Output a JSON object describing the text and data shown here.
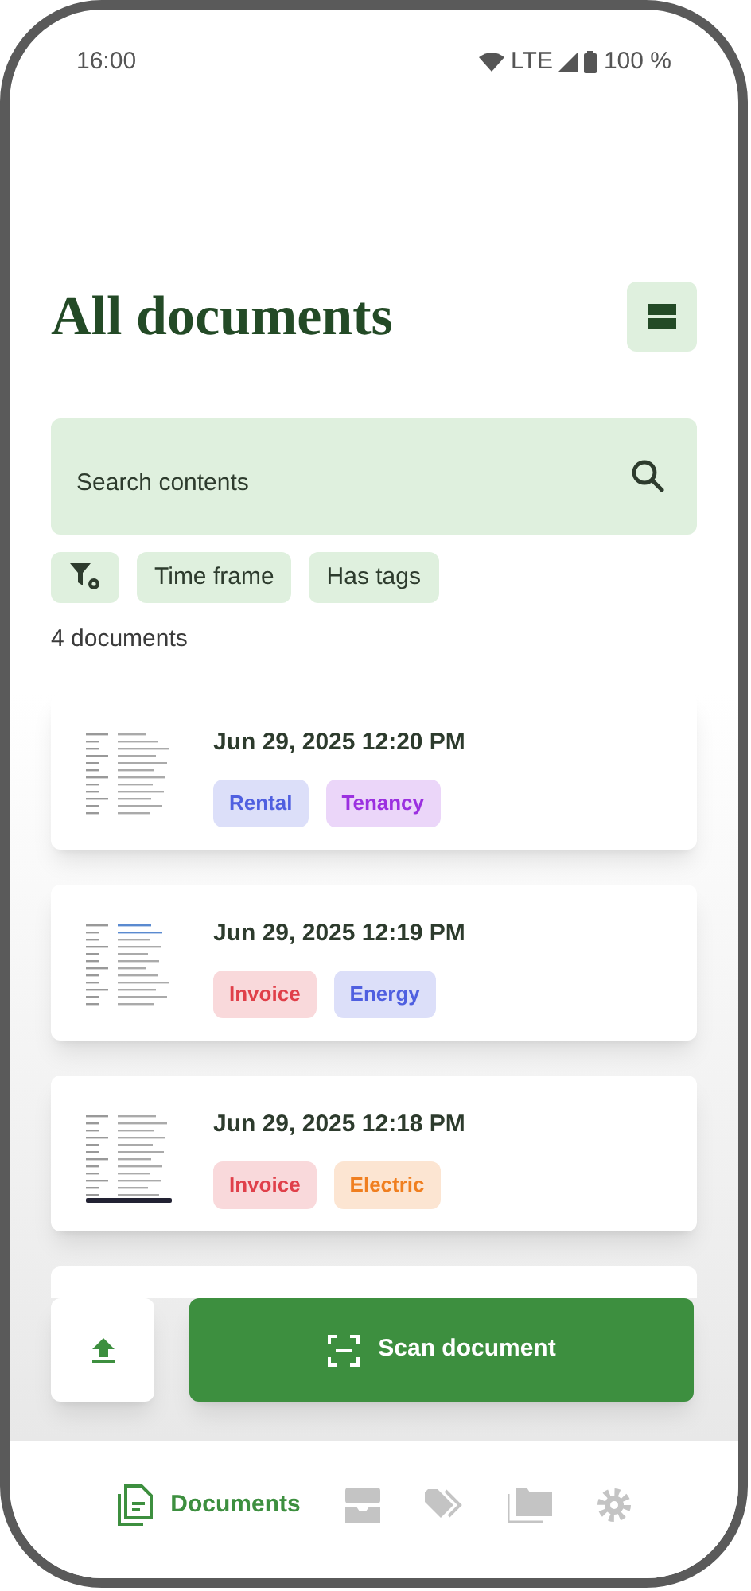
{
  "status_bar": {
    "time": "16:00",
    "network": "LTE",
    "battery": "100 %"
  },
  "title": "All documents",
  "search": {
    "placeholder": "Search contents"
  },
  "filters": [
    {
      "kind": "icon"
    },
    {
      "kind": "chip",
      "label": "Time frame"
    },
    {
      "kind": "chip",
      "label": "Has tags"
    }
  ],
  "count": "4 documents",
  "documents": [
    {
      "date": "Jun 29, 2025 12:20 PM",
      "tags": [
        {
          "label": "Rental",
          "color": "#4f5fe0"
        },
        {
          "label": "Tenancy",
          "color": "#9b30e0"
        }
      ]
    },
    {
      "date": "Jun 29, 2025 12:19 PM",
      "tags": [
        {
          "label": "Invoice",
          "color": "#e0404a"
        },
        {
          "label": "Energy",
          "color": "#4f5fe0"
        }
      ]
    },
    {
      "date": "Jun 29, 2025 12:18 PM",
      "tags": [
        {
          "label": "Invoice",
          "color": "#e0404a"
        },
        {
          "label": "Electric",
          "color": "#f07f20"
        }
      ]
    },
    {
      "kind": "partial"
    }
  ],
  "scan_button": "Scan document",
  "nav": [
    {
      "kind": "documents",
      "label": "Documents",
      "selected": true
    },
    {
      "kind": "inbox",
      "selected": false
    },
    {
      "kind": "tags",
      "selected": false
    },
    {
      "kind": "folders",
      "selected": false
    },
    {
      "kind": "settings",
      "selected": false
    }
  ]
}
